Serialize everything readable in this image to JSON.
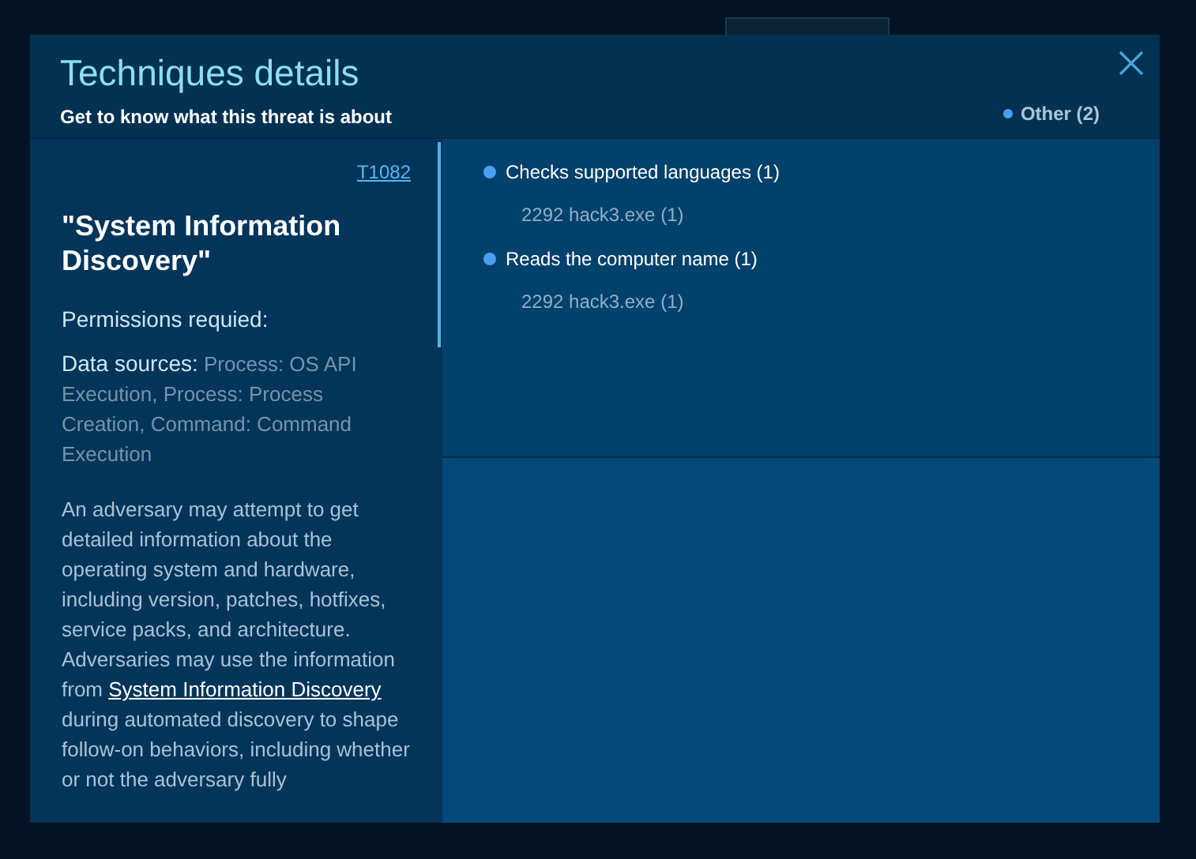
{
  "dialog": {
    "title": "Techniques details",
    "subtitle": "Get to know what this threat is about",
    "filter": {
      "label": "Other (**2**)",
      "color": "#4a9ff0"
    }
  },
  "technique": {
    "id": "T1082",
    "name": "\"System Information Discovery\"",
    "permissions_label": "Permissions requied:",
    "data_sources_label": "Data sources:",
    "data_sources": "Process: OS API Execution, Process: Process Creation, Command: Command Execution",
    "description_before": "An adversary may attempt to get detailed information about the operating system and hardware, including version, patches, hotfixes, service packs, and architecture. Adversaries may use the information from",
    "description_link": "System Information Discovery",
    "description_after": "during automated discovery to shape follow-on behaviors, including whether or not the adversary fully"
  },
  "behaviors": [
    {
      "title": "Checks supported languages (1)",
      "color": "#4a9ff0",
      "process": "2292 hack3.exe (1)"
    },
    {
      "title": "Reads the computer name (1)",
      "color": "#4a9ff0",
      "process": "2292 hack3.exe (1)"
    }
  ]
}
